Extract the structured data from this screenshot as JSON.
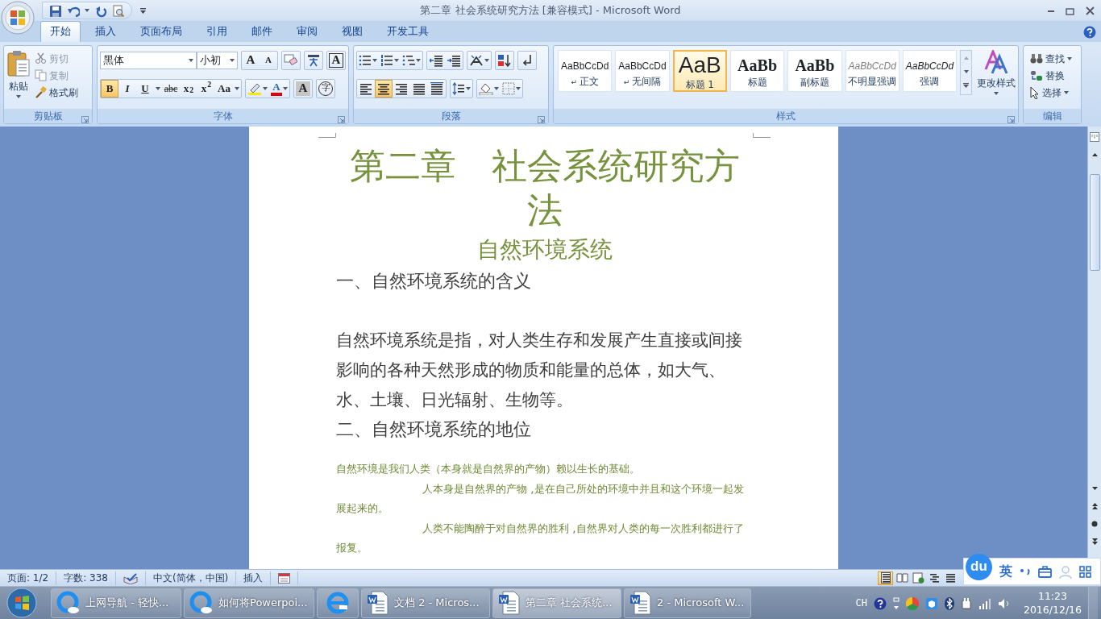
{
  "window": {
    "title": "第二章  社会系统研究方法 [兼容模式] - Microsoft Word"
  },
  "tabs": [
    {
      "label": "开始",
      "selected": true
    },
    {
      "label": "插入",
      "selected": false
    },
    {
      "label": "页面布局",
      "selected": false
    },
    {
      "label": "引用",
      "selected": false
    },
    {
      "label": "邮件",
      "selected": false
    },
    {
      "label": "审阅",
      "selected": false
    },
    {
      "label": "视图",
      "selected": false
    },
    {
      "label": "开发工具",
      "selected": false
    }
  ],
  "clipboard": {
    "group_label": "剪贴板",
    "paste": "粘贴",
    "commands": [
      {
        "kind": "cut",
        "label": "剪切",
        "disabled": true
      },
      {
        "kind": "copy",
        "label": "复制",
        "disabled": true
      },
      {
        "kind": "painter",
        "label": "格式刷",
        "disabled": false
      }
    ]
  },
  "font": {
    "group_label": "字体",
    "family": "黑体",
    "size": "小初",
    "grow": "A",
    "shrink": "A",
    "border": "A",
    "formats": [
      {
        "kind": "bold",
        "label": "B",
        "selected": true
      },
      {
        "kind": "italic",
        "label": "I",
        "selected": false
      },
      {
        "kind": "underline",
        "label": "U",
        "selected": false
      },
      {
        "kind": "strike",
        "label": "abc",
        "selected": false
      },
      {
        "kind": "script",
        "label": "x$_{2}$",
        "selected": false
      },
      {
        "kind": "script",
        "label": "x$^{2}$",
        "selected": false
      },
      {
        "kind": "case",
        "label": "Aa",
        "selected": false
      }
    ],
    "font_color": "A",
    "shading": "A",
    "enclosed": "字"
  },
  "paragraph": {
    "group_label": "段落",
    "alignment": [
      {
        "kind": "left",
        "selected": false
      },
      {
        "kind": "center",
        "selected": true
      },
      {
        "kind": "right",
        "selected": false
      },
      {
        "kind": "justify",
        "selected": false
      },
      {
        "kind": "distributed",
        "selected": false
      }
    ]
  },
  "styles": {
    "group_label": "样式",
    "change_styles": "更改样式",
    "items": [
      {
        "kind": "normal",
        "sample": "AaBbCcDd",
        "mark": "↵",
        "label": "正文",
        "selected": false
      },
      {
        "kind": "normal",
        "sample": "AaBbCcDd",
        "mark": "↵",
        "label": "无间隔",
        "selected": false
      },
      {
        "kind": "h1",
        "sample": "AaB",
        "label": "标题 1",
        "selected": true
      },
      {
        "kind": "serif",
        "sample": "AaBb",
        "label": "标题",
        "selected": false
      },
      {
        "kind": "serif",
        "sample": "AaBb",
        "label": "副标题",
        "selected": false
      },
      {
        "kind": "subtle",
        "sample": "AaBbCcDd",
        "label": "不明显强调",
        "selected": false
      },
      {
        "kind": "emphasis",
        "sample": "AaBbCcDd",
        "label": "强调",
        "selected": false
      }
    ]
  },
  "editing": {
    "group_label": "编辑",
    "commands": [
      {
        "kind": "find",
        "label": "查找",
        "dropdown": true
      },
      {
        "kind": "replace",
        "label": "替换",
        "dropdown": false
      },
      {
        "kind": "select",
        "label": "选择",
        "dropdown": true
      }
    ]
  },
  "document": {
    "blocks": [
      {
        "kind": "title",
        "text": "第二章　社会系统研究方法"
      },
      {
        "kind": "subtitle",
        "text": "自然环境系统"
      },
      {
        "kind": "heading",
        "text": "一、自然环境系统的含义"
      },
      {
        "kind": "body",
        "text": "自然环境系统是指，对人类生存和发展产生直接或间接影响的各种天然形成的物质和能量的总体，如大气、水、土壤、日光辐射、生物等。"
      },
      {
        "kind": "heading",
        "text": "二、自然环境系统的地位"
      },
      {
        "kind": "note",
        "text": "自然环境是我们人类（本身就是自然界的产物）赖以生长的基础。"
      },
      {
        "kind": "note_indent",
        "text": "人本身是自然界的产物 ,是在自己所处的环境中并且和这个环境一起发展起来的。"
      },
      {
        "kind": "note_indent",
        "text": "人类不能陶醉于对自然界的胜利 ,自然界对人类的每一次胜利都进行了报复。"
      }
    ]
  },
  "status_bar": {
    "items": [
      {
        "kind": "text",
        "text": "页面: 1/2"
      },
      {
        "kind": "text",
        "text": "字数: 338"
      },
      {
        "kind": "proofing"
      },
      {
        "kind": "text",
        "text": "中文(简体，中国)"
      },
      {
        "kind": "text",
        "text": "插入"
      },
      {
        "kind": "macro"
      }
    ],
    "views": [
      {
        "kind": "print",
        "selected": true
      },
      {
        "kind": "reading",
        "selected": false
      },
      {
        "kind": "web",
        "selected": false
      },
      {
        "kind": "outline",
        "selected": false
      },
      {
        "kind": "draft",
        "selected": false
      }
    ]
  },
  "ime": {
    "logo": "du",
    "mode": "英"
  },
  "taskbar": {
    "buttons": [
      {
        "kind": "browser",
        "label": "上网导航 - 轻快...",
        "selected": false
      },
      {
        "kind": "browser",
        "label": "如何将Powerpoi...",
        "selected": false
      },
      {
        "kind": "ie",
        "selected": false
      },
      {
        "kind": "word",
        "label": "文档 2 - Micros...",
        "selected": false
      },
      {
        "kind": "word",
        "label": "第二章  社会系统...",
        "selected": true
      },
      {
        "kind": "word",
        "label": "2 - Microsoft W...",
        "selected": false
      }
    ],
    "language": "CH",
    "time": "11:23",
    "date": "2016/12/16"
  }
}
